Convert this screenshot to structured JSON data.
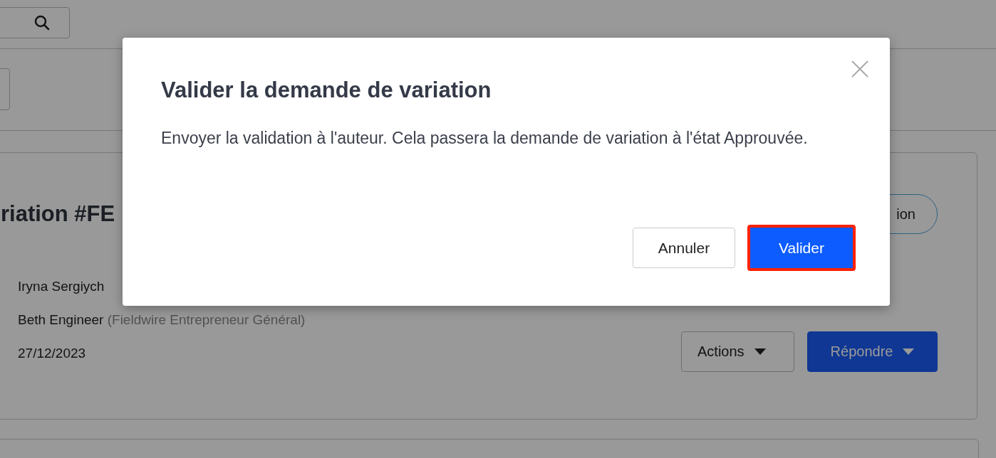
{
  "background": {
    "title": "riation #FE",
    "status_pill": "ion",
    "people": [
      {
        "name": "Iryna Sergiych"
      },
      {
        "name": "Beth Engineer",
        "role": "(Fieldwire Entrepreneur Général)"
      }
    ],
    "date": "27/12/2023",
    "buttons": [
      {
        "label": "Actions",
        "kind": "secondary"
      },
      {
        "label": "Répondre",
        "kind": "primary"
      }
    ]
  },
  "dialog": {
    "title": "Valider la demande de variation",
    "message": "Envoyer la validation à l'auteur. Cela passera la demande de variation à l'état Approuvée.",
    "buttons": [
      {
        "label": "Annuler",
        "kind": "secondary",
        "highlighted": false
      },
      {
        "label": "Valider",
        "kind": "primary",
        "highlighted": true
      }
    ]
  }
}
